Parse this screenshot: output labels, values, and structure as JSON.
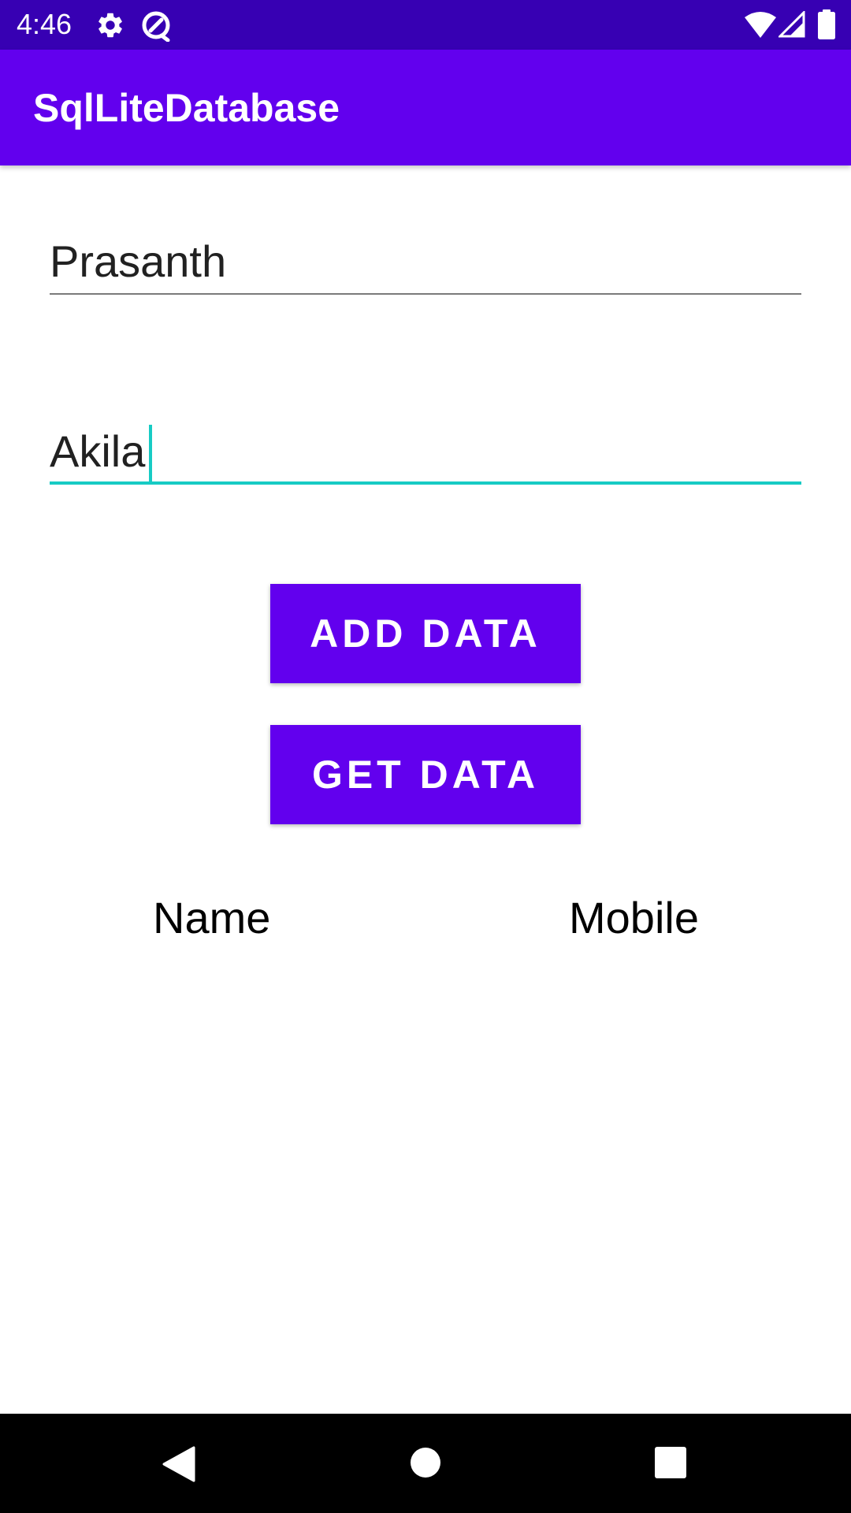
{
  "status_bar": {
    "time": "4:46",
    "background_color": "#3700b3",
    "icons": [
      "settings-icon",
      "sync-icon",
      "wifi-icon",
      "signal-icon",
      "battery-icon"
    ]
  },
  "app_bar": {
    "title": "SqlLiteDatabase",
    "background_color": "#6200ee"
  },
  "form": {
    "name_field": {
      "value": "Prasanth"
    },
    "mobile_field": {
      "value": "Akila",
      "focused": true,
      "accent_color": "#17cbc4"
    }
  },
  "buttons": {
    "add_label": "ADD DATA",
    "get_label": "GET DATA",
    "color": "#6200ee"
  },
  "table": {
    "headers": [
      "Name",
      "Mobile"
    ]
  },
  "nav_bar": {
    "icons": [
      "back-icon",
      "home-icon",
      "recents-icon"
    ]
  }
}
